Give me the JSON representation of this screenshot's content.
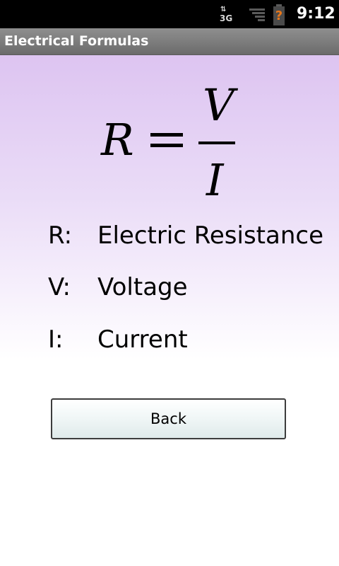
{
  "status_bar": {
    "network_label": "3G",
    "network_icon": "data-transfer-3g-icon",
    "signal_icon": "signal-strength-icon",
    "battery_icon": "battery-unknown-icon",
    "battery_mark": "?",
    "time": "9:12"
  },
  "title_bar": {
    "title": "Electrical Formulas"
  },
  "formula": {
    "lhs": "R",
    "operator": "=",
    "numerator": "V",
    "denominator": "I"
  },
  "variables": [
    {
      "symbol": "R:",
      "description": "Electric Resistance"
    },
    {
      "symbol": "V:",
      "description": "Voltage"
    },
    {
      "symbol": "I:",
      "description": "Current"
    }
  ],
  "back_button": {
    "label": "Back"
  },
  "colors": {
    "status_bar_bg": "#000000",
    "title_bar_bg": "#7a7a7a",
    "content_gradient_top": "#ddc4f1",
    "content_gradient_bottom": "#ffffff",
    "battery_accent": "#e8771a"
  }
}
